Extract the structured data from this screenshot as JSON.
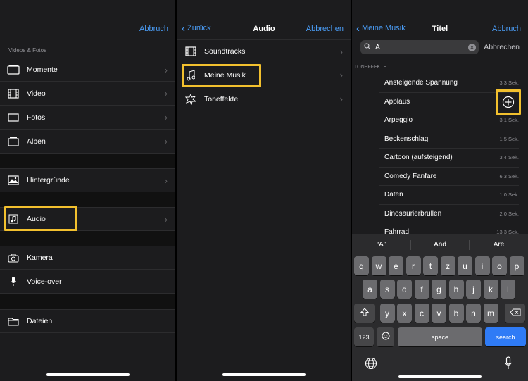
{
  "panel1": {
    "nav_right": "Abbruch",
    "section_label": "Videos & Fotos",
    "items": [
      {
        "label": "Momente",
        "icon": "moments-icon"
      },
      {
        "label": "Video",
        "icon": "film-icon"
      },
      {
        "label": "Fotos",
        "icon": "photo-frame-icon"
      },
      {
        "label": "Alben",
        "icon": "album-icon"
      },
      {
        "label": "Hintergründe",
        "icon": "landscape-icon"
      },
      {
        "label": "Audio",
        "icon": "music-note-icon"
      },
      {
        "label": "Kamera",
        "icon": "camera-icon"
      },
      {
        "label": "Voice-over",
        "icon": "microphone-icon"
      },
      {
        "label": "Dateien",
        "icon": "folder-icon"
      }
    ]
  },
  "panel2": {
    "nav_left": "Zurück",
    "nav_title": "Audio",
    "nav_right": "Abbrechen",
    "items": [
      {
        "label": "Soundtracks",
        "icon": "film-icon"
      },
      {
        "label": "Meine Musik",
        "icon": "music-note-icon"
      },
      {
        "label": "Toneffekte",
        "icon": "burst-icon"
      }
    ]
  },
  "panel3": {
    "nav_left": "Meine Musik",
    "nav_title": "Titel",
    "nav_right": "Abbruch",
    "search_value": "A",
    "search_cancel": "Abbrechen",
    "section_label": "TONEFFEKTE",
    "tones": [
      {
        "name": "Ansteigende Spannung",
        "duration": "3.3 Sek."
      },
      {
        "name": "Applaus",
        "duration": ""
      },
      {
        "name": "Arpeggio",
        "duration": "3.1 Sek."
      },
      {
        "name": "Beckenschlag",
        "duration": "1.5 Sek."
      },
      {
        "name": "Cartoon (aufsteigend)",
        "duration": "3.4 Sek."
      },
      {
        "name": "Comedy Fanfare",
        "duration": "6.3 Sek."
      },
      {
        "name": "Daten",
        "duration": "1.0 Sek."
      },
      {
        "name": "Dinosaurierbrüllen",
        "duration": "2.0 Sek."
      },
      {
        "name": "Fahrrad",
        "duration": "13.3 Sek."
      }
    ],
    "keyboard": {
      "suggestions": [
        "“A”",
        "And",
        "Are"
      ],
      "row1": [
        "q",
        "w",
        "e",
        "r",
        "t",
        "z",
        "u",
        "i",
        "o",
        "p"
      ],
      "row2": [
        "a",
        "s",
        "d",
        "f",
        "g",
        "h",
        "j",
        "k",
        "l"
      ],
      "row3": [
        "y",
        "x",
        "c",
        "v",
        "b",
        "n",
        "m"
      ],
      "numbers_key": "123",
      "space_key": "space",
      "search_key": "search"
    }
  },
  "colors": {
    "accent": "#4a9cf5",
    "highlight": "#f2c02e",
    "background": "#1c1c1e",
    "search_key": "#2f7bf6"
  }
}
